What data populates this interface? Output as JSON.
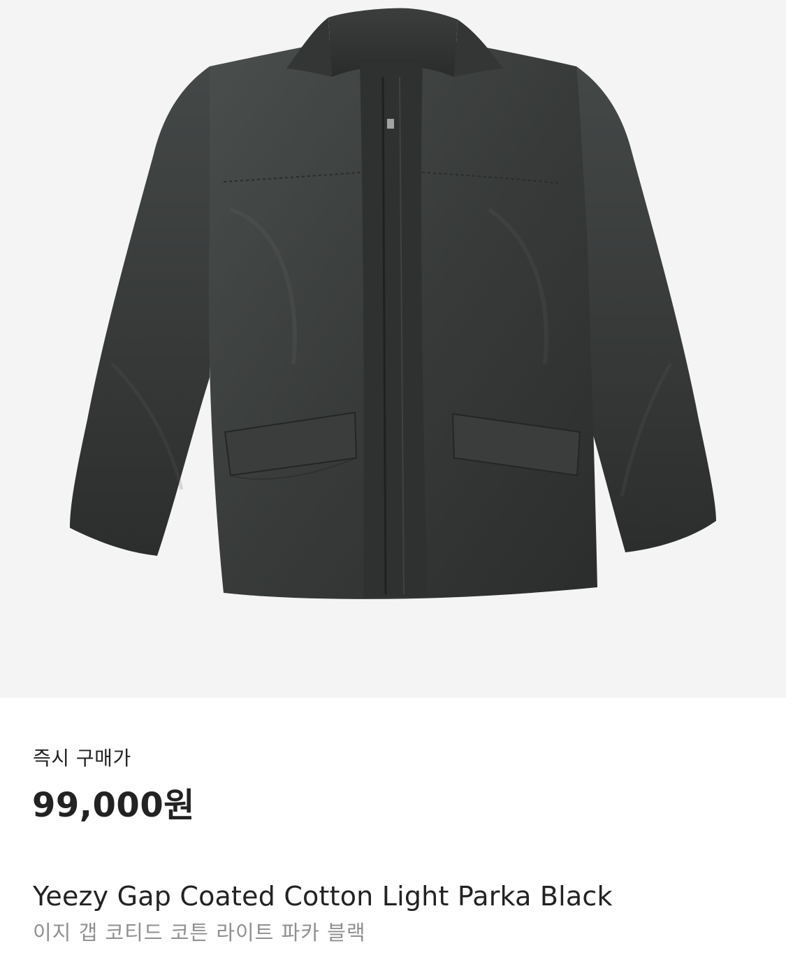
{
  "product": {
    "image_alt": "Yeezy Gap Coated Cotton Light Parka Black",
    "image_background": "#f4f4f4",
    "garment_color": "#3a3d3c"
  },
  "price": {
    "label": "즉시 구매가",
    "value": "99,000원"
  },
  "names": {
    "english": "Yeezy Gap Coated Cotton Light Parka Black",
    "korean": "이지 갭 코티드 코튼 라이트 파카 블랙"
  }
}
